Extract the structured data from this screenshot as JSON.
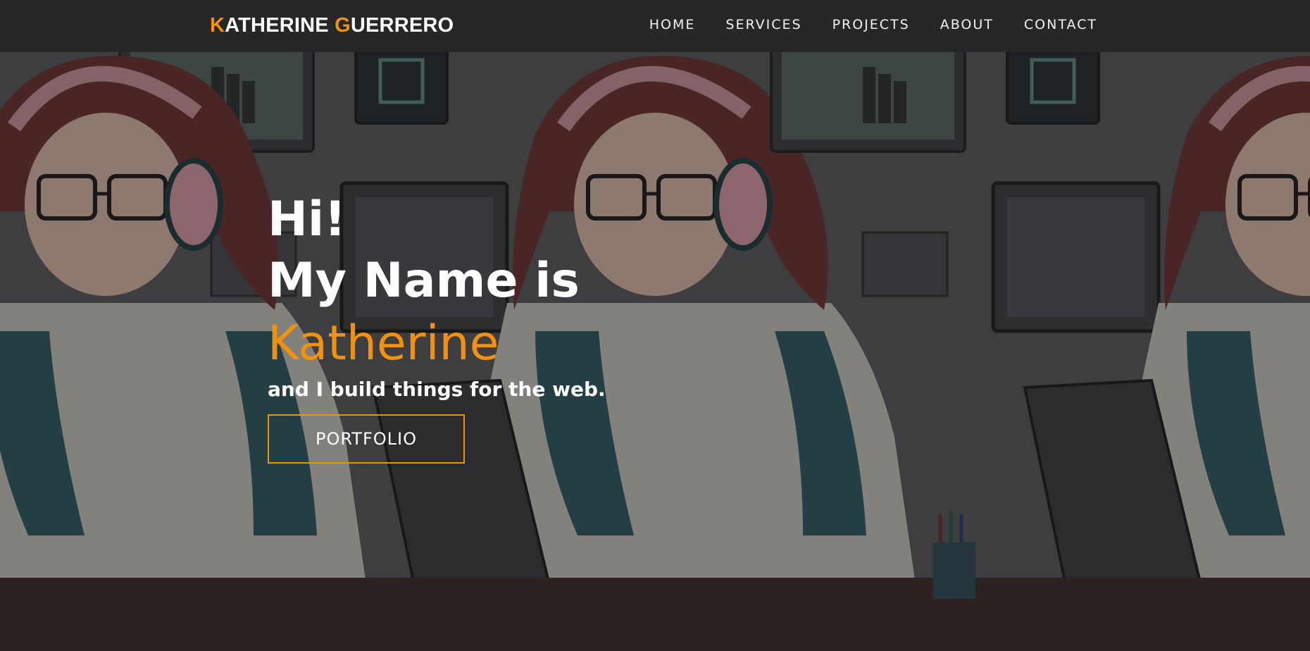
{
  "colors": {
    "accent": "#f0920e",
    "navbar_bg": "#262626",
    "text": "#ffffff"
  },
  "navbar": {
    "brand_first_initial": "K",
    "brand_first_rest": "ATHERINE ",
    "brand_last_initial": "G",
    "brand_last_rest": "UERRERO",
    "links": [
      {
        "label": "HOME"
      },
      {
        "label": "SERVICES"
      },
      {
        "label": "PROJECTS"
      },
      {
        "label": "ABOUT"
      },
      {
        "label": "CONTACT"
      }
    ]
  },
  "hero": {
    "greeting": "Hi!",
    "intro": "My Name is",
    "name": "Katherine",
    "tagline": "and I build things for the web.",
    "cta_label": "PORTFOLIO"
  },
  "background": {
    "description_icon": "illustration-woman-with-headphones-at-laptop"
  }
}
